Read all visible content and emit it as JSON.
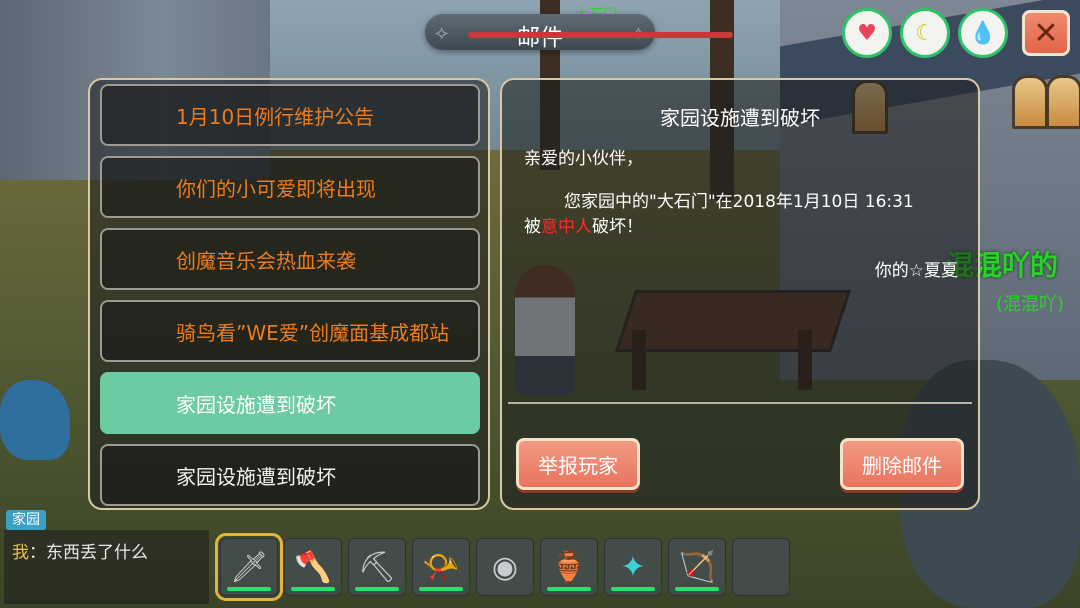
{
  "hud": {
    "mail_title": "邮件",
    "player_tag": "大石门",
    "status_icons": [
      "heart-icon",
      "banana-icon",
      "water-drop-icon"
    ],
    "status_colors": [
      "#e8455a",
      "#d7c227",
      "#1ea7c8"
    ],
    "close_label": "✕"
  },
  "mail_list": [
    {
      "title": "1月10日例行维护公告",
      "state": "unread"
    },
    {
      "title": "你们的小可爱即将出现",
      "state": "unread"
    },
    {
      "title": "创魔音乐会热血来袭",
      "state": "unread"
    },
    {
      "title": "骑鸟看”WE爱”创魔面基成都站",
      "state": "unread"
    },
    {
      "title": "家园设施遭到破坏",
      "state": "selected"
    },
    {
      "title": "家园设施遭到破坏",
      "state": "read"
    }
  ],
  "mail_detail": {
    "title": "家园设施遭到破坏",
    "greeting": "亲爱的小伙伴，",
    "body_prefix": "您家园中的\"大石门\"在2018年1月10日 16:31",
    "body_line2_start": "被",
    "body_highlight": "意中人",
    "body_line2_end": "破坏！",
    "signature": "你的☆夏夏",
    "report_label": "举报玩家",
    "delete_label": "删除邮件"
  },
  "world": {
    "nearby_player": "混混吖的",
    "nearby_player_sub": "(混混吖)"
  },
  "chat": {
    "channel": "家园",
    "sender": "我",
    "message": "：东西丢了什么"
  },
  "hotbar": [
    {
      "icon": "sword-icon",
      "glyph": "🗡",
      "active": true
    },
    {
      "icon": "axe-icon",
      "glyph": "🪓",
      "active": false
    },
    {
      "icon": "pickaxe-icon",
      "glyph": "⛏",
      "active": false
    },
    {
      "icon": "horn-icon",
      "glyph": "📯",
      "active": false
    },
    {
      "icon": "shield-disc-icon",
      "glyph": "◉",
      "active": false
    },
    {
      "icon": "gourd-icon",
      "glyph": "🏺",
      "active": false
    },
    {
      "icon": "magic-staff-icon",
      "glyph": "✦",
      "active": false
    },
    {
      "icon": "bow-icon",
      "glyph": "🏹",
      "active": false
    }
  ]
}
